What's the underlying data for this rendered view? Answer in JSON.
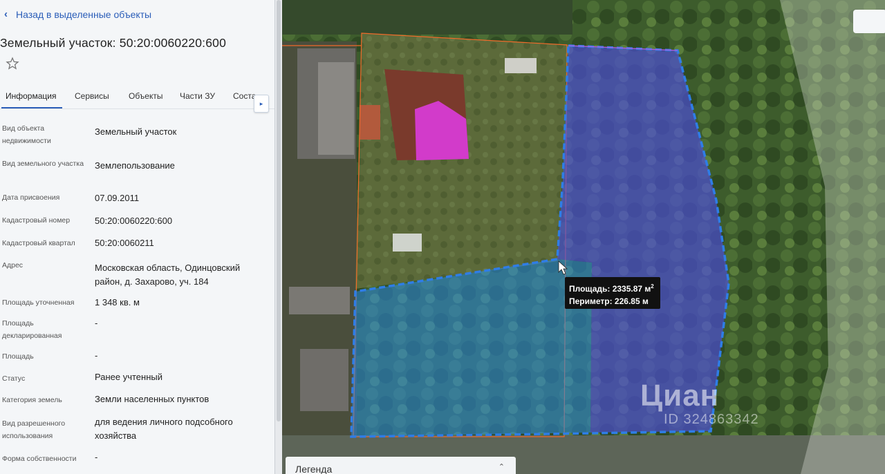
{
  "panel": {
    "back_label": "Назад в выделенные объекты",
    "title": "Земельный участок: 50:20:0060220:600",
    "tabs": [
      "Информация",
      "Сервисы",
      "Объекты",
      "Части ЗУ",
      "Соста"
    ],
    "rows": [
      {
        "label": "Вид объекта недвижимости",
        "value": "Земельный участок"
      },
      {
        "label": "Вид земельного участка",
        "value": "Землепользование"
      },
      {
        "label": "Дата присвоения",
        "value": "07.09.2011"
      },
      {
        "label": "Кадастровый номер",
        "value": "50:20:0060220:600"
      },
      {
        "label": "Кадастровый квартал",
        "value": "50:20:0060211"
      },
      {
        "label": "Адрес",
        "value": "Московская область, Одинцовский район, д. Захарово, уч. 184"
      },
      {
        "label": "Площадь уточненная",
        "value": "1 348 кв. м"
      },
      {
        "label": "Площадь декларированная",
        "value": "-"
      },
      {
        "label": "Площадь",
        "value": "-"
      },
      {
        "label": "Статус",
        "value": "Ранее учтенный"
      },
      {
        "label": "Категория земель",
        "value": "Земли населенных пунктов"
      },
      {
        "label": "Вид разрешенного использования",
        "value": "для ведения личного подсобного хозяйства"
      },
      {
        "label": "Форма собственности",
        "value": "-"
      }
    ]
  },
  "map": {
    "tooltip_area_label": "Площадь: 2335.87 м",
    "tooltip_area_sup": "2",
    "tooltip_perimeter": "Периметр: 226.85 м",
    "legend_label": "Легенда",
    "watermark": "Циан",
    "watermark_id": "ID 324863342",
    "colors": {
      "selection_blue": "#2f7de6",
      "measure_fill": "#4d4de0",
      "building_fill": "#e23ce6",
      "boundary_orange": "#f06a2a"
    }
  }
}
